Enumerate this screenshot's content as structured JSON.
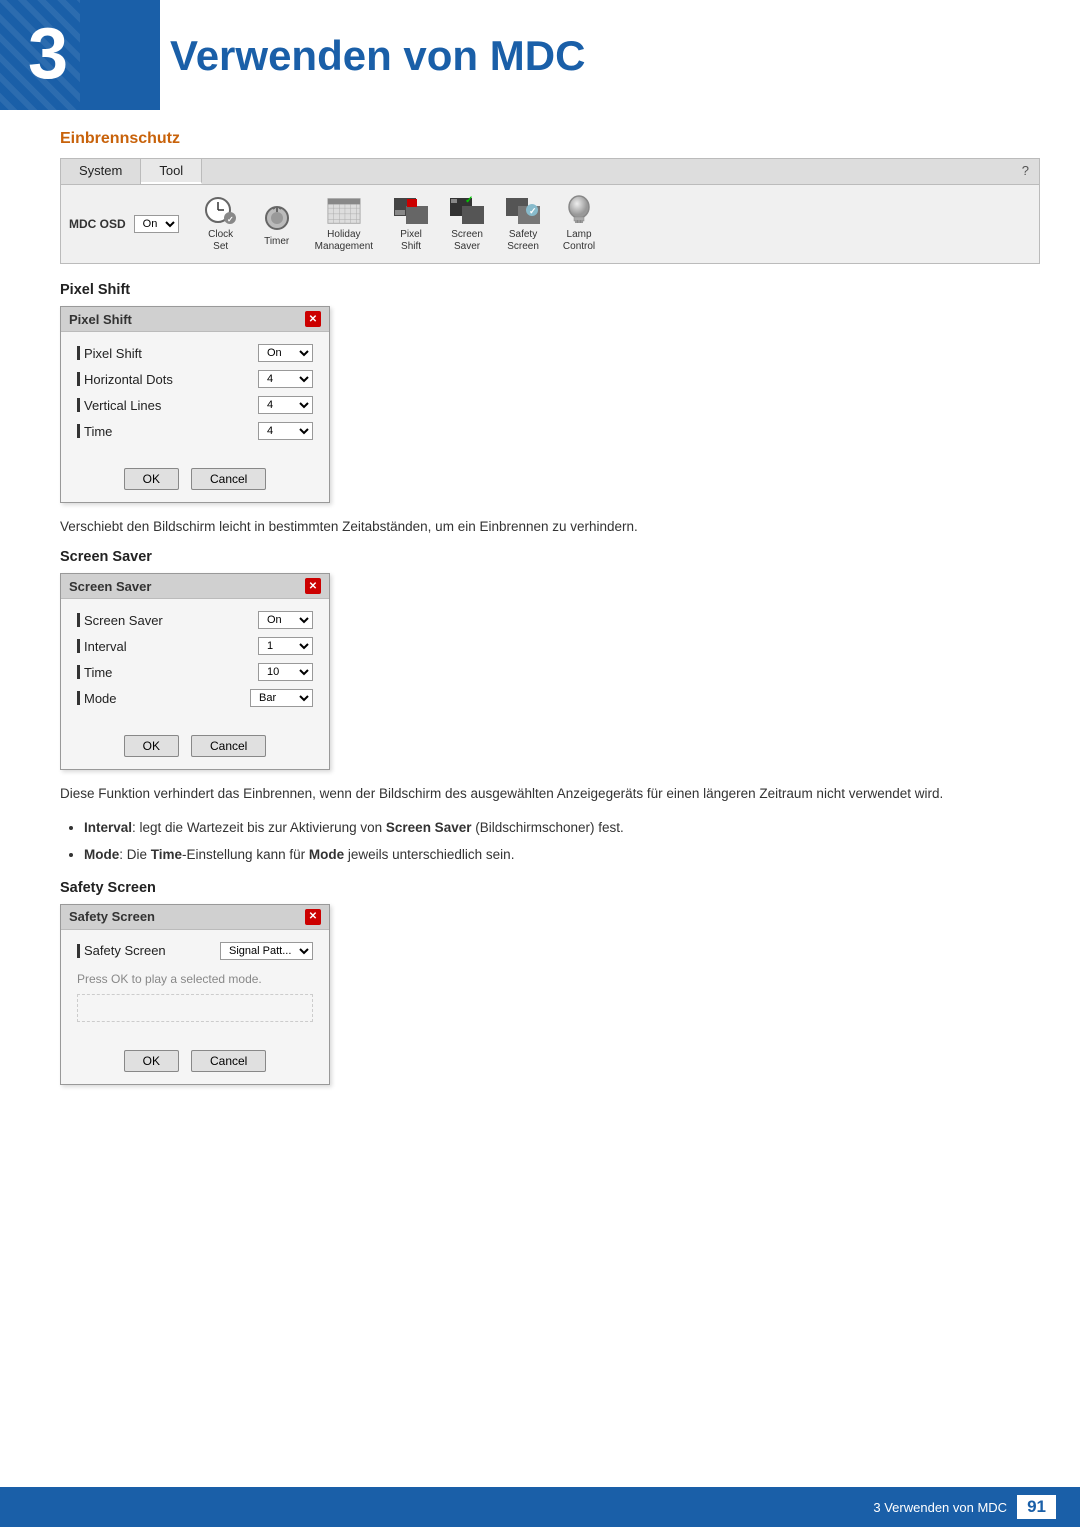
{
  "header": {
    "chapter_number": "3",
    "title": "Verwenden von MDC"
  },
  "section": {
    "title": "Einbrennschutz"
  },
  "mdc_panel": {
    "tabs": [
      "System",
      "Tool"
    ],
    "active_tab": "Tool",
    "question_icon": "?",
    "osd_label": "MDC OSD",
    "osd_value": "On",
    "toolbar_items": [
      {
        "id": "clock-set",
        "label": "Clock\nSet"
      },
      {
        "id": "timer",
        "label": "Timer"
      },
      {
        "id": "holiday",
        "label": "Holiday\nManagement"
      },
      {
        "id": "pixel-shift",
        "label": "Pixel\nShift"
      },
      {
        "id": "screen-saver",
        "label": "Screen\nSaver"
      },
      {
        "id": "safety-screen",
        "label": "Safety\nScreen"
      },
      {
        "id": "lamp-control",
        "label": "Lamp\nControl"
      }
    ]
  },
  "pixel_shift": {
    "dialog_title": "Pixel Shift",
    "rows": [
      {
        "label": "Pixel Shift",
        "value": "On",
        "has_dropdown": true
      },
      {
        "label": "Horizontal Dots",
        "value": "4",
        "has_dropdown": true
      },
      {
        "label": "Vertical Lines",
        "value": "4",
        "has_dropdown": true
      },
      {
        "label": "Time",
        "value": "4",
        "has_dropdown": true
      }
    ],
    "ok_label": "OK",
    "cancel_label": "Cancel"
  },
  "pixel_shift_desc": "Verschiebt den Bildschirm leicht in bestimmten Zeitabständen, um ein Einbrennen zu verhindern.",
  "screen_saver": {
    "dialog_title": "Screen Saver",
    "rows": [
      {
        "label": "Screen Saver",
        "value": "On",
        "has_dropdown": true
      },
      {
        "label": "Interval",
        "value": "1",
        "has_dropdown": true
      },
      {
        "label": "Time",
        "value": "10",
        "has_dropdown": true
      },
      {
        "label": "Mode",
        "value": "Bar",
        "has_dropdown": true
      }
    ],
    "ok_label": "OK",
    "cancel_label": "Cancel"
  },
  "screen_saver_desc": "Diese Funktion verhindert das Einbrennen, wenn der Bildschirm des ausgewählten Anzeigegeräts für einen längeren Zeitraum nicht verwendet wird.",
  "screen_saver_bullets": [
    {
      "bold_start": "Interval",
      "text": ": legt die Wartezeit bis zur Aktivierung von ",
      "bold_mid": "Screen Saver",
      "text2": " (Bildschirmschoner) fest."
    },
    {
      "bold_start": "Mode",
      "text": ": Die ",
      "bold_mid": "Time",
      "text2": "-Einstellung kann für ",
      "bold_end": "Mode",
      "text3": " jeweils unterschiedlich sein."
    }
  ],
  "safety_screen": {
    "section_label": "Safety Screen",
    "dialog_title": "Safety Screen",
    "rows": [
      {
        "label": "Safety Screen",
        "value": "Signal Patt...",
        "has_dropdown": true
      }
    ],
    "note": "Press OK to play a selected mode.",
    "ok_label": "OK",
    "cancel_label": "Cancel"
  },
  "footer": {
    "text": "3 Verwenden von MDC",
    "page_number": "91"
  }
}
